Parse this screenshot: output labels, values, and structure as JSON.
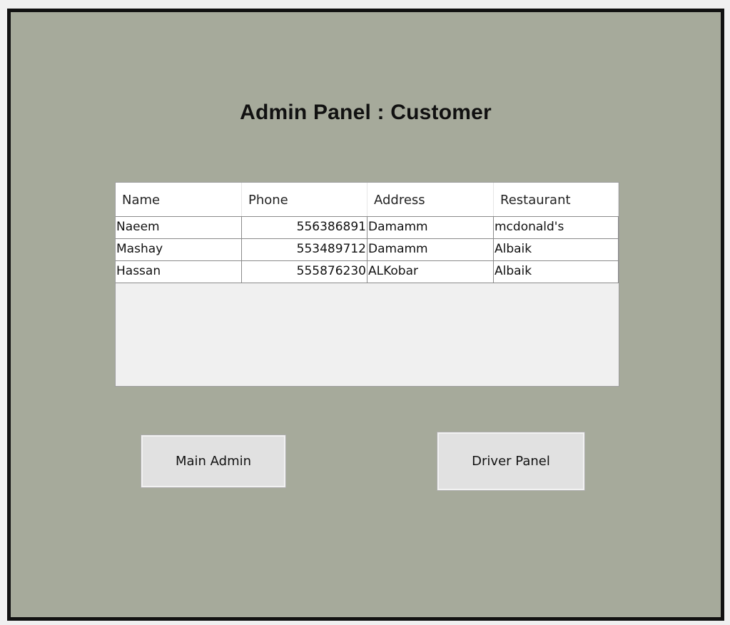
{
  "window": {
    "title": "Admin Panel : Customer"
  },
  "table": {
    "columns": [
      "Name",
      "Phone",
      "Address",
      "Restaurant"
    ],
    "rows": [
      {
        "name": "Naeem",
        "phone": "556386891",
        "address": "Damamm",
        "restaurant": "mcdonald's"
      },
      {
        "name": "Mashay",
        "phone": "553489712",
        "address": "Damamm",
        "restaurant": "Albaik"
      },
      {
        "name": "Hassan",
        "phone": "555876230",
        "address": "ALKobar",
        "restaurant": "Albaik"
      }
    ]
  },
  "buttons": {
    "main_admin": "Main Admin",
    "driver_panel": "Driver Panel"
  },
  "colors": {
    "panel_background": "#a6aa9b",
    "frame_border": "#111111",
    "grid_empty_area": "#f0f0f0",
    "button_face": "#e1e1e1"
  }
}
